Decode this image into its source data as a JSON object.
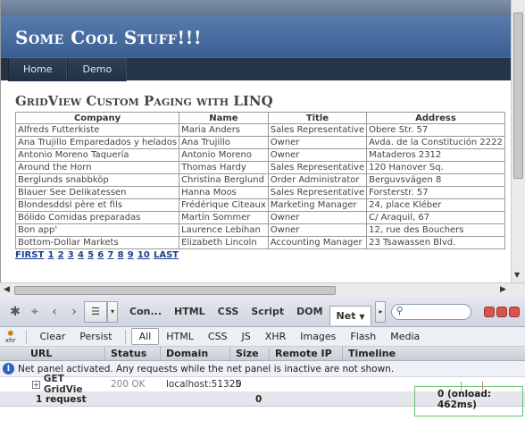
{
  "site": {
    "title": "Some Cool Stuff!!!",
    "menu": [
      "Home",
      "Demo"
    ]
  },
  "page": {
    "heading": "GridView Custom Paging with LINQ"
  },
  "grid": {
    "columns": [
      "Company",
      "Name",
      "Title",
      "Address"
    ],
    "rows": [
      [
        "Alfreds Futterkiste",
        "Maria Anders",
        "Sales Representative",
        "Obere Str. 57"
      ],
      [
        "Ana Trujillo Emparedados y helados",
        "Ana Trujillo",
        "Owner",
        "Avda. de la Constitución 2222"
      ],
      [
        "Antonio Moreno Taquería",
        "Antonio Moreno",
        "Owner",
        "Mataderos 2312"
      ],
      [
        "Around the Horn",
        "Thomas Hardy",
        "Sales Representative",
        "120 Hanover Sq."
      ],
      [
        "Berglunds snabbköp",
        "Christina Berglund",
        "Order Administrator",
        "Berguvsvägen 8"
      ],
      [
        "Blauer See Delikatessen",
        "Hanna Moos",
        "Sales Representative",
        "Forsterstr. 57"
      ],
      [
        "Blondesddsl père et fils",
        "Frédérique Citeaux",
        "Marketing Manager",
        "24, place Kléber"
      ],
      [
        "Bólido Comidas preparadas",
        "Martín Sommer",
        "Owner",
        "C/ Araquil, 67"
      ],
      [
        "Bon app'",
        "Laurence Lebihan",
        "Owner",
        "12, rue des Bouchers"
      ],
      [
        "Bottom-Dollar Markets",
        "Elizabeth Lincoln",
        "Accounting Manager",
        "23 Tsawassen Blvd."
      ]
    ],
    "pager": {
      "first": "FIRST",
      "pages": [
        "1",
        "2",
        "3",
        "4",
        "5",
        "6",
        "7",
        "8",
        "9",
        "10"
      ],
      "last": "LAST"
    }
  },
  "firebug": {
    "tabs": [
      "Con...",
      "HTML",
      "CSS",
      "Script",
      "DOM",
      "Net"
    ],
    "selected_tab": "Net",
    "filters": [
      "Clear",
      "Persist",
      "All",
      "HTML",
      "CSS",
      "JS",
      "XHR",
      "Images",
      "Flash",
      "Media"
    ],
    "selected_filter": "All",
    "xhr_label": "xhr",
    "columns": [
      "URL",
      "Status",
      "Domain",
      "Size",
      "Remote IP",
      "Timeline"
    ],
    "notice": "Net panel activated. Any requests while the net panel is inactive are not shown.",
    "request": {
      "expander": "+",
      "method_url": "GET GridVie",
      "status": "200 OK",
      "domain": "localhost:51325",
      "size": "0"
    },
    "summary": {
      "requests": "1 request",
      "size": "0",
      "timing": "0 (onload: 462ms)"
    }
  }
}
